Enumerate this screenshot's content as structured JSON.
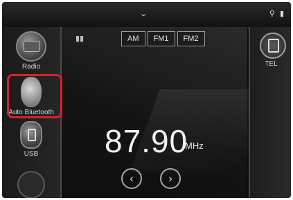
{
  "topbar": {
    "chevron": "⌄",
    "status_icons": [
      "wifi-icon",
      "phone-icon"
    ]
  },
  "sidebar": {
    "items": [
      {
        "label": "Radio",
        "icon": "radio-icon"
      },
      {
        "label": "Auto Bluetooth",
        "icon": "bluetooth-icon"
      },
      {
        "label": "USB",
        "icon": "usb-icon"
      },
      {
        "label": "",
        "icon": "source-icon"
      }
    ],
    "highlight_color": "#d3232f"
  },
  "main": {
    "band_icon": "▮▮",
    "bands": [
      "AM",
      "FM1",
      "FM2"
    ],
    "frequency": "87.90",
    "unit": "MHz",
    "seek_back": "‹",
    "seek_forward": "›"
  },
  "right": {
    "label": "TEL",
    "icon": "tel-icon"
  }
}
